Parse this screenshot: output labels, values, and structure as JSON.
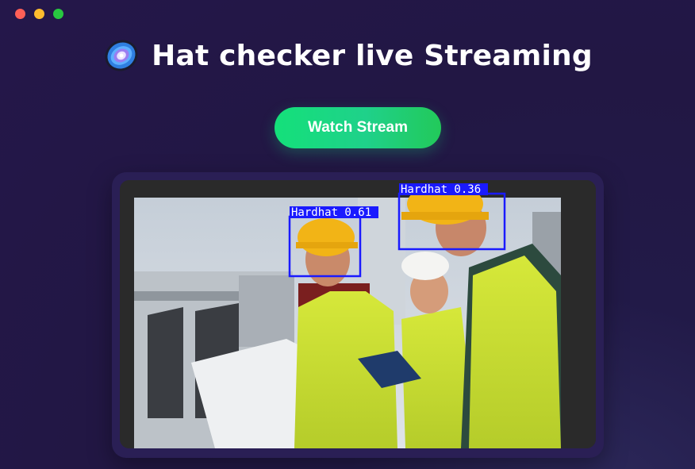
{
  "window": {
    "controls": [
      "close",
      "minimize",
      "maximize"
    ]
  },
  "header": {
    "title": "Hat checker live Streaming",
    "icon": "galaxy-icon"
  },
  "actions": {
    "watch_stream_label": "Watch Stream"
  },
  "stream": {
    "detections": [
      {
        "label": "Hardhat 0.61",
        "class": "Hardhat",
        "confidence": 0.61
      },
      {
        "label": "Hardhat 0.36",
        "class": "Hardhat",
        "confidence": 0.36
      }
    ]
  },
  "colors": {
    "background": "#221744",
    "button_start": "#14e07a",
    "button_end": "#22c95a",
    "detection_box": "#1a1aff",
    "close": "#ff5f57",
    "minimize": "#febc2e",
    "maximize": "#28c840"
  }
}
